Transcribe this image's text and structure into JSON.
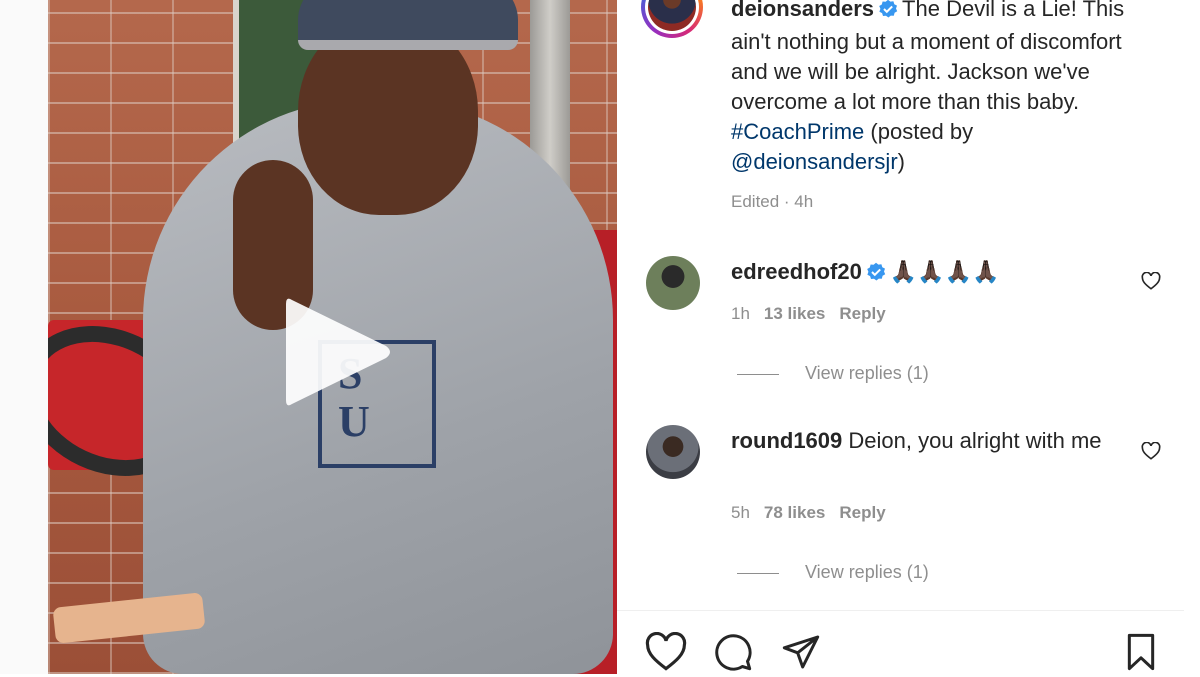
{
  "post": {
    "username": "deionsanders",
    "caption_text": "The Devil is a Lie! This ain't nothing but a moment of discomfort and we will be alright. Jackson we've overcome a lot more than this baby.",
    "hashtag": "#CoachPrime",
    "posted_by_prefix": "(posted by",
    "mention": "@deionsandersjr",
    "posted_by_suffix": ")",
    "edited_time": "Edited · 4h"
  },
  "comments": [
    {
      "username": "edreedhof20",
      "text": "🙏🏿🙏🏿🙏🏿🙏🏿",
      "time": "1h",
      "likes": "13 likes",
      "reply_label": "Reply",
      "view_replies": "View replies (1)"
    },
    {
      "username": "round1609",
      "text": "Deion, you alright with me",
      "time": "5h",
      "likes": "78 likes",
      "reply_label": "Reply",
      "view_replies": "View replies (1)"
    }
  ],
  "icons": {
    "play": "play-icon",
    "verified": "verified-badge-icon",
    "like": "heart-icon",
    "comment": "comment-icon",
    "share": "share-icon",
    "save": "bookmark-icon"
  },
  "colors": {
    "verified": "#3897f0",
    "link": "#00376b",
    "muted": "#8e8e8e"
  }
}
